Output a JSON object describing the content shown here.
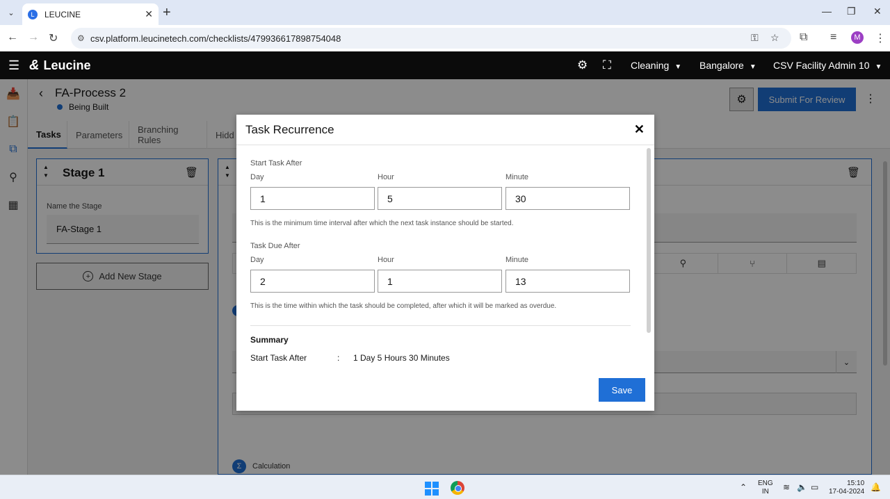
{
  "browser": {
    "tab_title": "LEUCINE",
    "url": "csv.platform.leucinetech.com/checklists/479936617898754048",
    "profile_initial": "M"
  },
  "header": {
    "brand": "Leucine",
    "dropdowns": [
      "Cleaning",
      "Bangalore",
      "CSV Facility Admin 10"
    ]
  },
  "page": {
    "title": "FA-Process 2",
    "status": "Being Built",
    "submit_label": "Submit For Review",
    "tabs": [
      "Tasks",
      "Parameters",
      "Branching Rules",
      "Hidd"
    ]
  },
  "stage": {
    "name": "Stage 1",
    "name_label": "Name the Stage",
    "name_value": "FA-Stage 1",
    "add_label": "Add New Stage"
  },
  "task": {
    "calc_label": "Calculation"
  },
  "modal": {
    "title": "Task Recurrence",
    "start": {
      "label": "Start Task After",
      "day_label": "Day",
      "hour_label": "Hour",
      "minute_label": "Minute",
      "day": "1",
      "hour": "5",
      "minute": "30",
      "helper": "This is the minimum time interval after which the next task instance should be started."
    },
    "due": {
      "label": "Task Due After",
      "day_label": "Day",
      "hour_label": "Hour",
      "minute_label": "Minute",
      "day": "2",
      "hour": "1",
      "minute": "13",
      "helper": "This is the time within which the task should be completed, after which it will be marked as overdue."
    },
    "summary": {
      "title": "Summary",
      "row_key": "Start Task After",
      "row_sep": ":",
      "row_value": "1 Day 5 Hours 30 Minutes"
    },
    "save_label": "Save"
  },
  "taskbar": {
    "lang_top": "ENG",
    "lang_bottom": "IN",
    "time": "15:10",
    "date": "17-04-2024"
  },
  "colors": {
    "primary": "#1f6fd6",
    "header_bg": "#0b0b0b"
  }
}
